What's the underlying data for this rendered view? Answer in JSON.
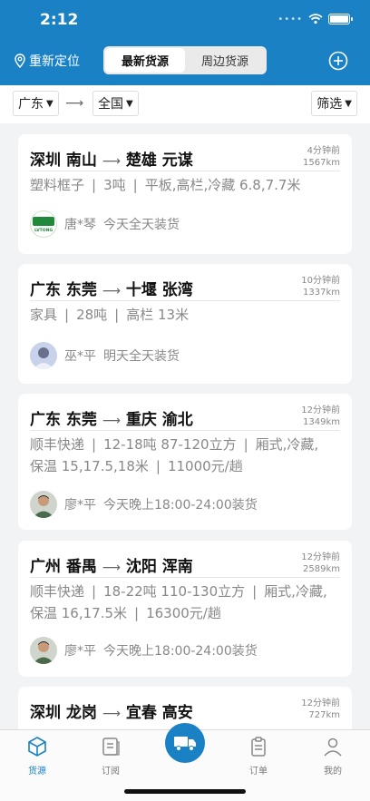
{
  "status": {
    "time": "2:12"
  },
  "nav": {
    "relocate_label": "重新定位",
    "tabs": [
      "最新货源",
      "周边货源"
    ]
  },
  "filters": {
    "origin": "广东",
    "destination": "全国",
    "filter_label": "筛选"
  },
  "cards": [
    {
      "route_from": "深圳 南山",
      "route_to": "楚雄 元谋",
      "ago": "4分钟前",
      "distance": "1567km",
      "info": [
        "塑料框子",
        "3吨",
        "平板,高栏,冷藏 6.8,7.7米"
      ],
      "user": "唐*琴",
      "load_time": "今天全天装货",
      "avatar_text": "LVTONG"
    },
    {
      "route_from": "广东 东莞",
      "route_to": "十堰 张湾",
      "ago": "10分钟前",
      "distance": "1337km",
      "info": [
        "家具",
        "28吨",
        "高栏 13米"
      ],
      "user": "巫*平",
      "load_time": "明天全天装货"
    },
    {
      "route_from": "广东 东莞",
      "route_to": "重庆 渝北",
      "ago": "12分钟前",
      "distance": "1349km",
      "info": [
        "顺丰快递",
        "12-18吨 87-120立方",
        "厢式,冷藏,",
        "保温 15,17.5,18米",
        "11000元/趟"
      ],
      "user": "廖*平",
      "load_time": "今天晚上18:00-24:00装货"
    },
    {
      "route_from": "广州 番禺",
      "route_to": "沈阳 浑南",
      "ago": "12分钟前",
      "distance": "2589km",
      "info": [
        "顺丰快递",
        "18-22吨 110-130立方",
        "厢式,冷藏,",
        "保温 16,17.5米",
        "16300元/趟"
      ],
      "user": "廖*平",
      "load_time": "今天晚上18:00-24:00装货"
    },
    {
      "route_from": "深圳 龙岗",
      "route_to": "宜春 高安",
      "ago": "12分钟前",
      "distance": "727km"
    }
  ],
  "tabbar": [
    {
      "label": "货源",
      "icon": "cube-icon"
    },
    {
      "label": "订阅",
      "icon": "subscribe-icon"
    },
    {
      "label": "",
      "icon": "truck-icon"
    },
    {
      "label": "订单",
      "icon": "clipboard-icon"
    },
    {
      "label": "我的",
      "icon": "person-icon"
    }
  ],
  "colors": {
    "brand": "#1a82c4",
    "background": "#f2f3f5"
  }
}
